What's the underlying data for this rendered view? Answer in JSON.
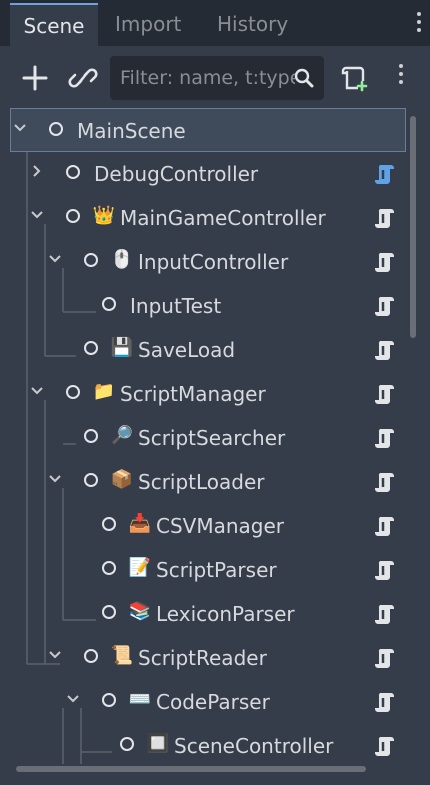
{
  "tabs": [
    {
      "label": "Scene"
    },
    {
      "label": "Import"
    },
    {
      "label": "History"
    }
  ],
  "toolbar": {
    "filter_placeholder": "Filter: name, t:type, g:group",
    "add_icon": "plus-icon",
    "link_icon": "link-icon",
    "attach_icon": "attach-script-icon"
  },
  "tree": {
    "nodes": [
      {
        "label": "MainScene",
        "emoji": ""
      },
      {
        "label": "DebugController",
        "emoji": ""
      },
      {
        "label": "MainGameController",
        "emoji": "👑"
      },
      {
        "label": "InputController",
        "emoji": "🖱️"
      },
      {
        "label": "InputTest",
        "emoji": ""
      },
      {
        "label": "SaveLoad",
        "emoji": "💾"
      },
      {
        "label": "ScriptManager",
        "emoji": "📁"
      },
      {
        "label": "ScriptSearcher",
        "emoji": "🔎"
      },
      {
        "label": "ScriptLoader",
        "emoji": "📦"
      },
      {
        "label": "CSVManager",
        "emoji": "📥"
      },
      {
        "label": "ScriptParser",
        "emoji": "📝"
      },
      {
        "label": "LexiconParser",
        "emoji": "📚"
      },
      {
        "label": "ScriptReader",
        "emoji": "📜"
      },
      {
        "label": "CodeParser",
        "emoji": "⌨️"
      },
      {
        "label": "SceneController",
        "emoji": "🔲"
      }
    ]
  },
  "colors": {
    "accent": "#6fa3df",
    "script_open": "#5fa3e6",
    "script": "#e3e5e8"
  }
}
